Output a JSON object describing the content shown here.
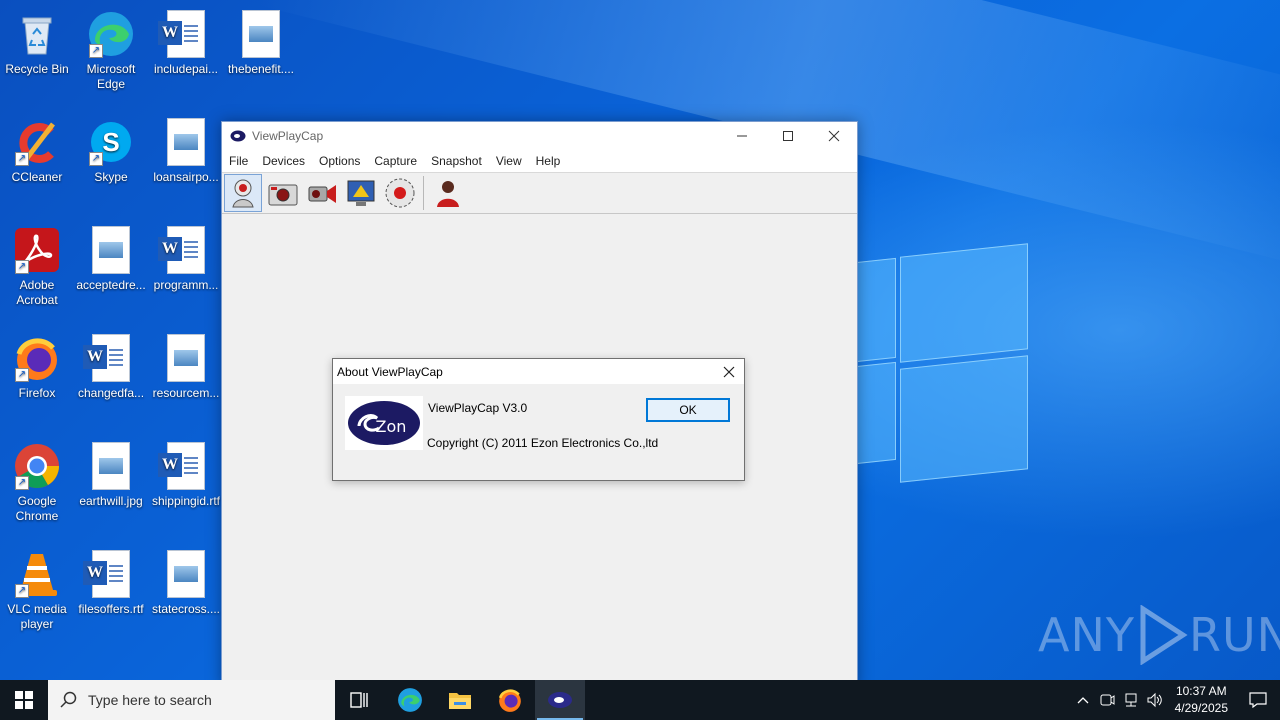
{
  "desktop": {
    "icons": [
      {
        "label": "Recycle Bin"
      },
      {
        "label": "Microsoft Edge"
      },
      {
        "label": "includepai..."
      },
      {
        "label": "thebenefit...."
      },
      {
        "label": "CCleaner"
      },
      {
        "label": "Skype"
      },
      {
        "label": "loansairpo..."
      },
      {
        "label": "Adobe Acrobat"
      },
      {
        "label": "acceptedre..."
      },
      {
        "label": "programm..."
      },
      {
        "label": "Firefox"
      },
      {
        "label": "changedfa..."
      },
      {
        "label": "resourcem..."
      },
      {
        "label": "Google Chrome"
      },
      {
        "label": "earthwill.jpg"
      },
      {
        "label": "shippingid.rtf"
      },
      {
        "label": "VLC media player"
      },
      {
        "label": "filesoffers.rtf"
      },
      {
        "label": "statecross...."
      }
    ]
  },
  "app": {
    "title": "ViewPlayCap",
    "menu": [
      "File",
      "Devices",
      "Options",
      "Capture",
      "Snapshot",
      "View",
      "Help"
    ]
  },
  "about": {
    "title": "About ViewPlayCap",
    "version": "ViewPlayCap V3.0",
    "copyright": "Copyright (C) 2011 Ezon Electronics Co.,ltd",
    "ok_label": "OK",
    "logo_text": "Zon"
  },
  "watermark": {
    "left": "ANY",
    "right": "RUN"
  },
  "taskbar": {
    "search_placeholder": "Type here to search",
    "time": "10:37 AM",
    "date": "4/29/2025"
  },
  "colors": {
    "accent": "#0078d7",
    "taskbar": "#101820",
    "desktop": "#0a63d8"
  }
}
